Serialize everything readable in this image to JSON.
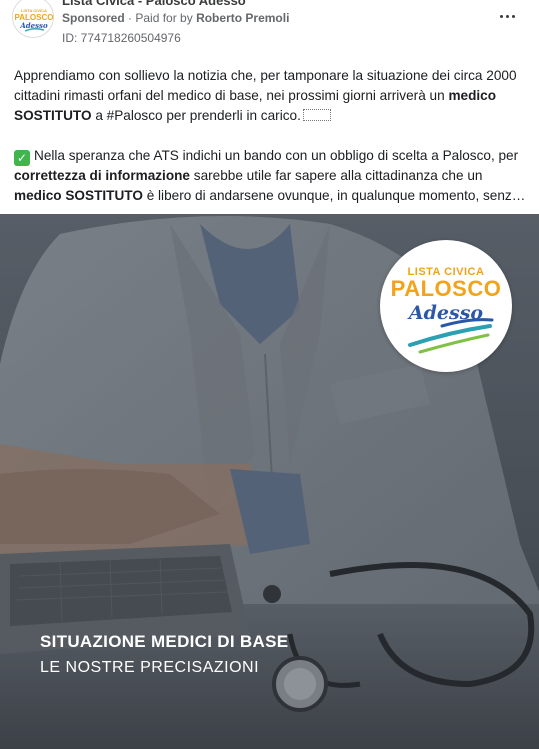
{
  "ad": {
    "page_name": "Lista Civica - Palosco Adesso",
    "sponsored": "Sponsored",
    "paid_for_prefix": "· Paid for by",
    "payer": "Roberto Premoli",
    "ad_id": "ID: 774718260504976"
  },
  "avatar_logo": {
    "line1": "LISTA CIVICA",
    "line2": "PALOSCO",
    "line3": "Adesso"
  },
  "post": {
    "p1_part1": "Apprendiamo con sollievo la notizia che, per tamponare la situazione dei circa 2000 cittadini rimasti orfani del medico di base, nei prossimi giorni arriverà un ",
    "p1_bold": "medico SOSTITUTO",
    "p1_part2": " a #Palosco per prenderli in carico.",
    "p2_part1": "Nella speranza che ATS indichi un bando con un obbligo di scelta a Palosco, per ",
    "p2_bold1": "correttezza di informazione",
    "p2_part2": " sarebbe utile far sapere alla cittadinanza che un",
    "p2_bold2": "medico SOSTITUTO",
    "p2_part3": " è libero di andarsene ovunque, in qualunque momento, senz…"
  },
  "image": {
    "logo_line1": "LISTA CIVICA",
    "logo_line2": "PALOSCO",
    "logo_line3": "Adesso",
    "caption_title": "SITUAZIONE MEDICI DI BASE",
    "caption_subtitle": "LE NOSTRE PRECISAZIONI"
  },
  "icons": [
    "more-options-icon",
    "check-mark-icon",
    "emoji-placeholder-icon"
  ],
  "colors": {
    "logo_orange": "#f2a31b",
    "logo_blue": "#2a57a8",
    "check_green": "#3fb54b",
    "meta_gray": "#65676b"
  }
}
